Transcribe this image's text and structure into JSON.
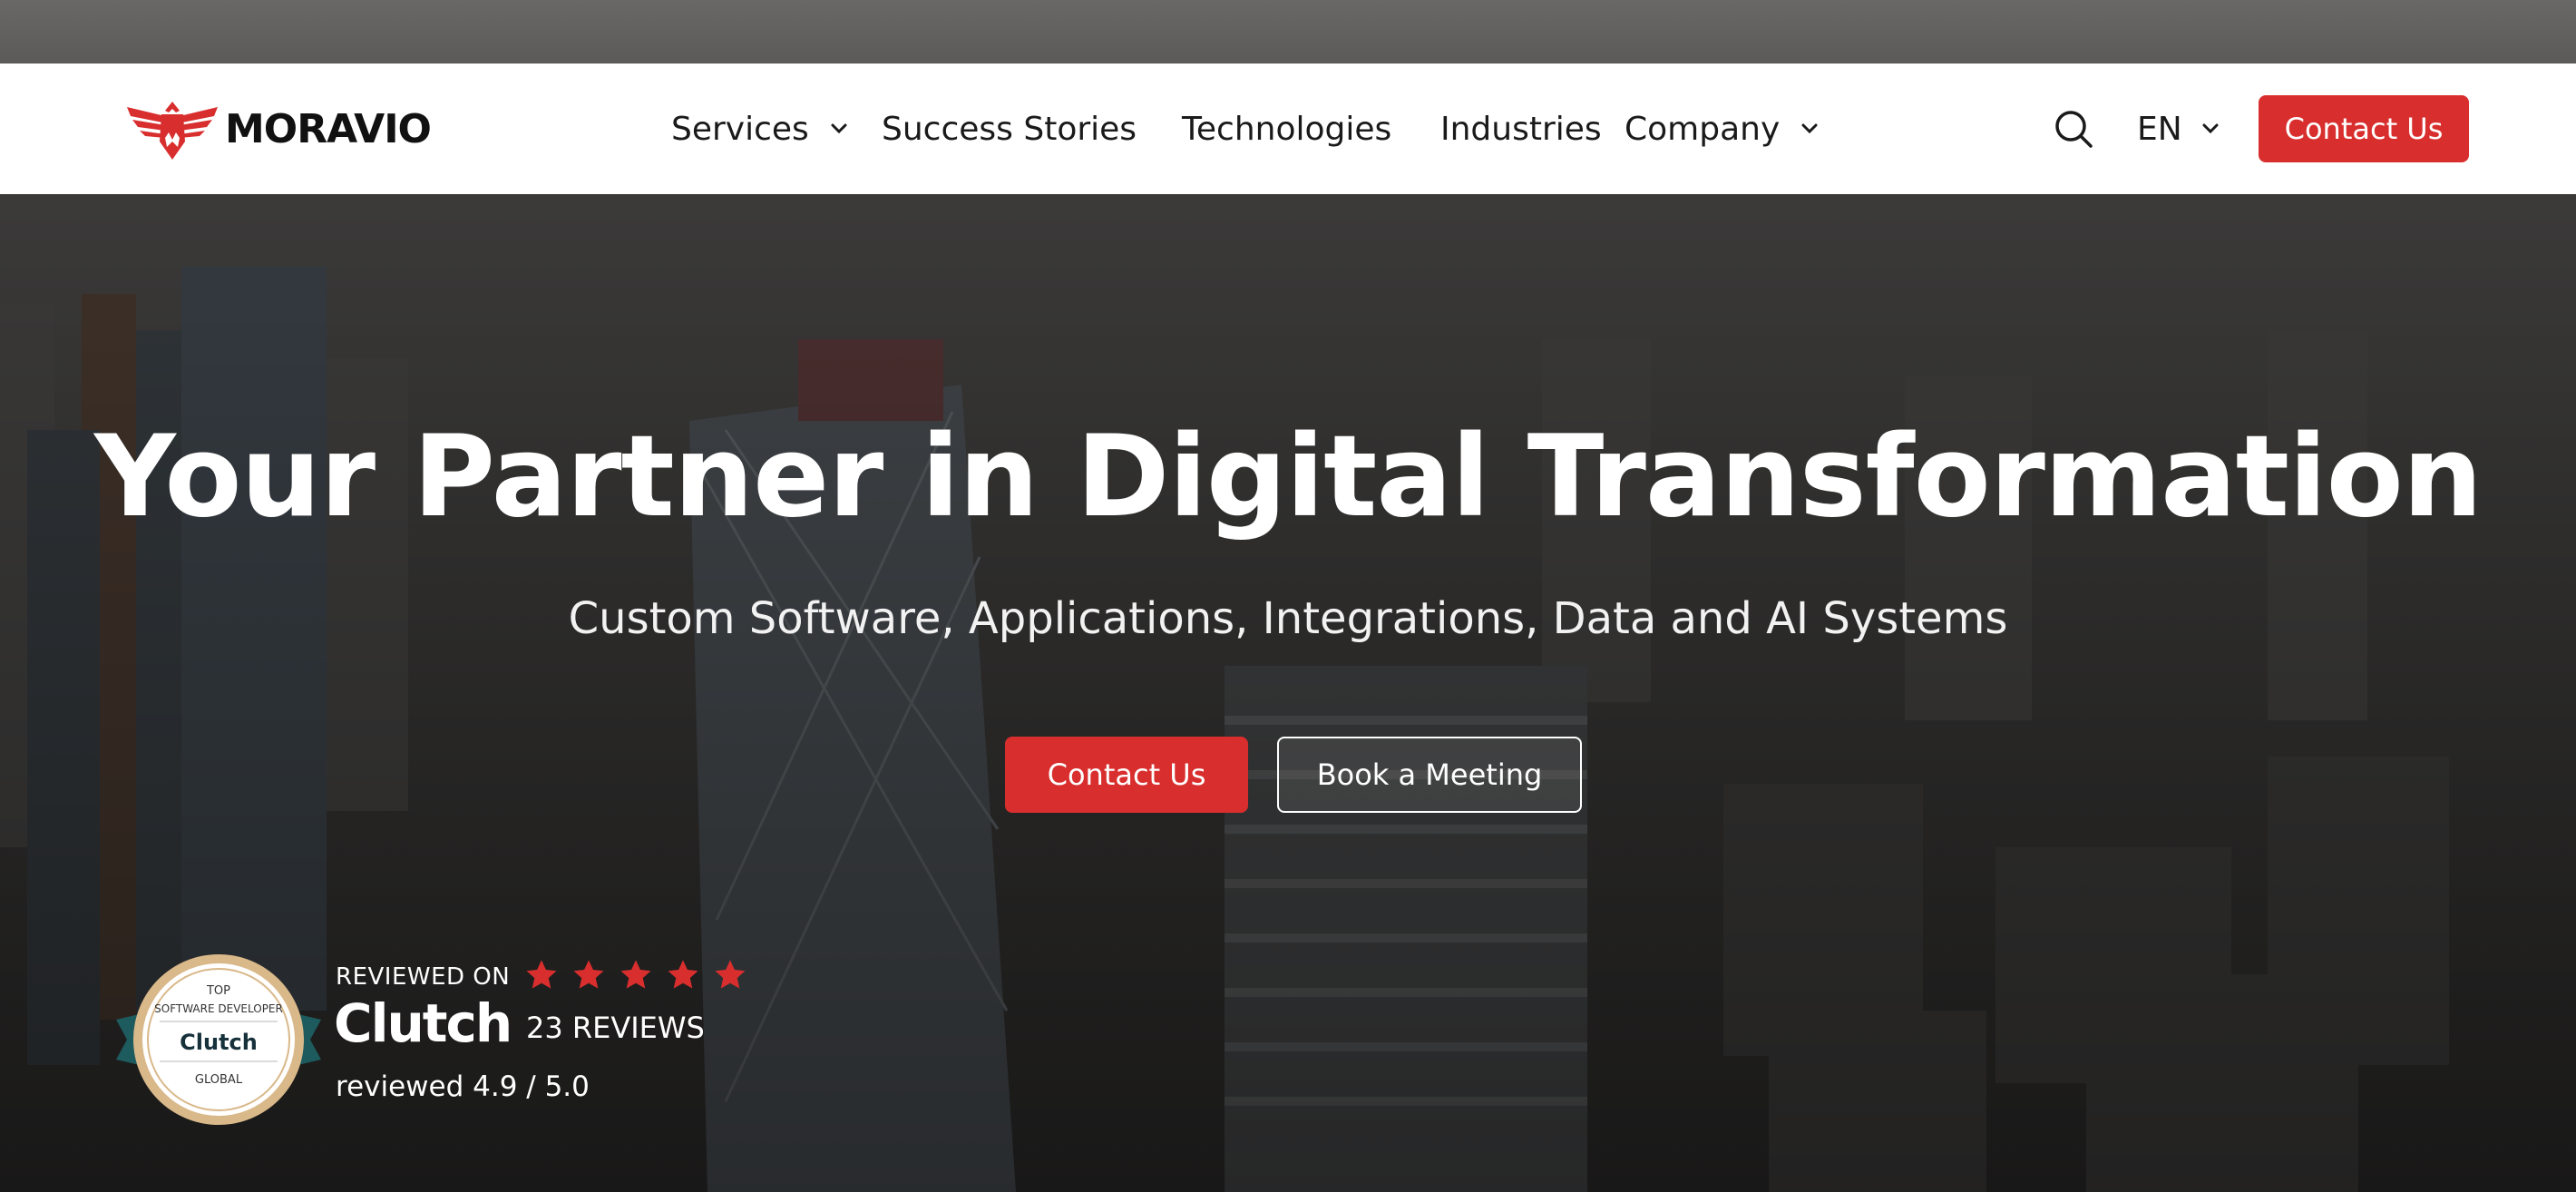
{
  "brand": {
    "name": "MORAVIO",
    "accent_color": "#d92e2e",
    "logo_icon": "eagle-icon"
  },
  "nav": {
    "items": [
      {
        "label": "Services",
        "has_dropdown": true
      },
      {
        "label": "Success Stories",
        "has_dropdown": false
      },
      {
        "label": "Technologies",
        "has_dropdown": false
      },
      {
        "label": "Industries",
        "has_dropdown": false
      },
      {
        "label": "Company",
        "has_dropdown": true
      }
    ],
    "search_icon": "search-icon",
    "language": "EN",
    "cta_label": "Contact Us"
  },
  "hero": {
    "title": "Your Partner in Digital Transformation",
    "subtitle": "Custom Software, Applications, Integrations, Data and AI Systems",
    "primary_cta": "Contact Us",
    "secondary_cta": "Book a Meeting"
  },
  "clutch": {
    "badge_lines": [
      "TOP",
      "SOFTWARE DEVELOPER",
      "Clutch",
      "GLOBAL"
    ],
    "reviewed_on": "REVIEWED ON",
    "wordmark": "Clutch",
    "stars": 5,
    "review_count": "23 REVIEWS",
    "rating": "reviewed 4.9 / 5.0"
  }
}
